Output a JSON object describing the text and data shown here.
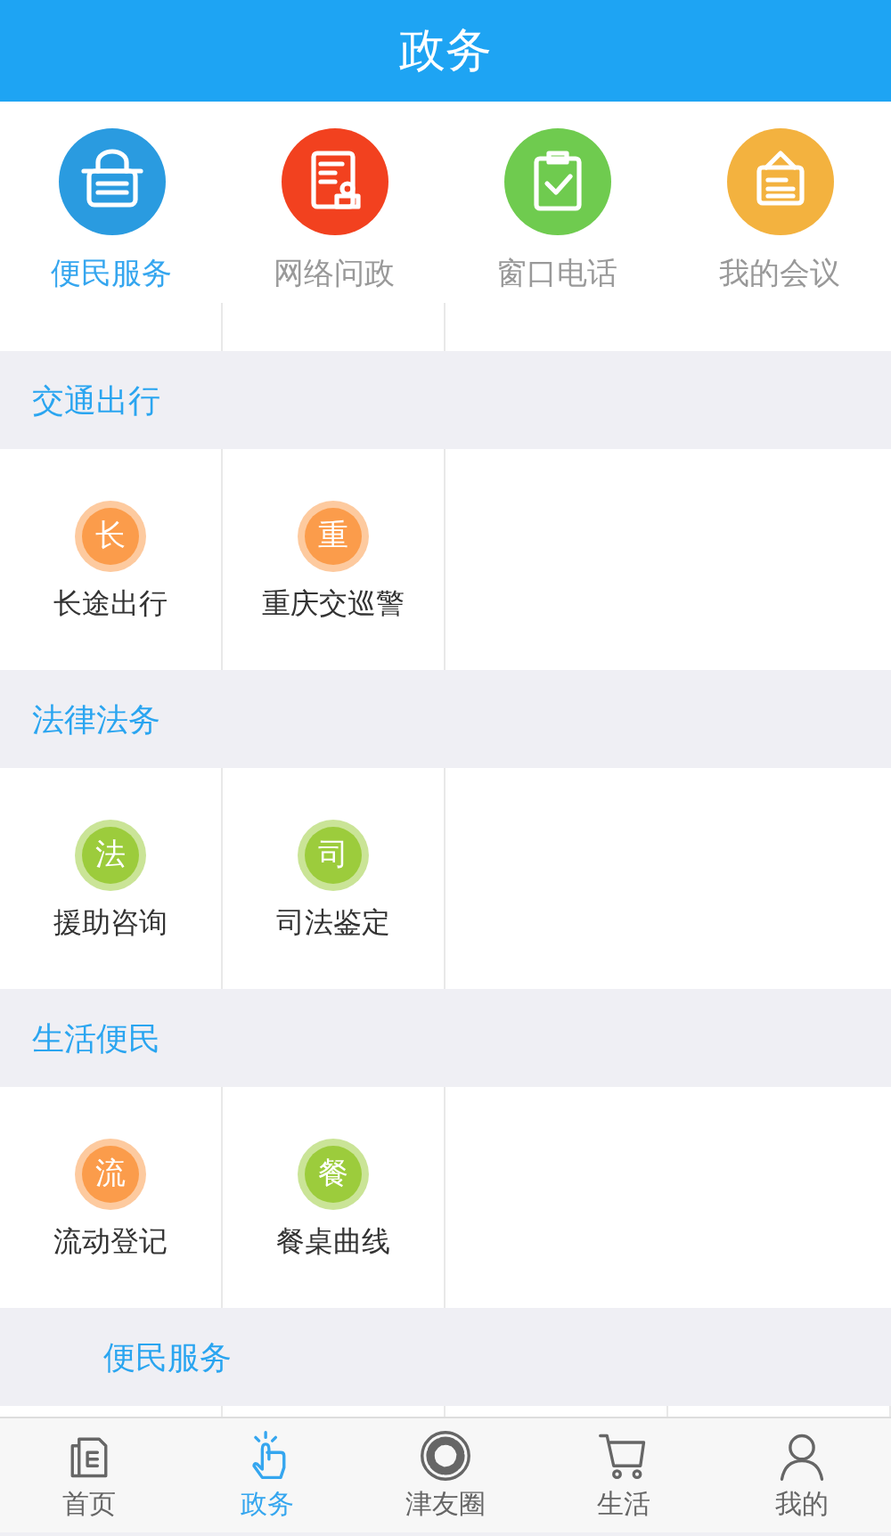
{
  "header": {
    "title": "政务"
  },
  "top_services": [
    {
      "label": "便民服务",
      "kind": "basket",
      "color": "#2a9be0",
      "selected": true
    },
    {
      "label": "网络问政",
      "kind": "document",
      "color": "#f2411f",
      "selected": false
    },
    {
      "label": "窗口电话",
      "kind": "clipboard",
      "color": "#6fcb4f",
      "selected": false
    },
    {
      "label": "我的会议",
      "kind": "sign",
      "color": "#f3b23f",
      "selected": false
    }
  ],
  "sections": [
    {
      "title": "交通出行",
      "items": [
        {
          "glyph": "长",
          "label": "长途出行",
          "color": "#fb9c4b"
        },
        {
          "glyph": "重",
          "label": "重庆交巡警",
          "color": "#fb9c4b"
        }
      ]
    },
    {
      "title": "法律法务",
      "items": [
        {
          "glyph": "法",
          "label": "援助咨询",
          "color": "#9ccc3c"
        },
        {
          "glyph": "司",
          "label": "司法鉴定",
          "color": "#9ccc3c"
        }
      ]
    },
    {
      "title": "生活便民",
      "items": [
        {
          "glyph": "流",
          "label": "流动登记",
          "color": "#fb9c4b"
        },
        {
          "glyph": "餐",
          "label": "餐桌曲线",
          "color": "#9ccc3c"
        }
      ]
    }
  ],
  "partial_section": {
    "title": "便民服务"
  },
  "tab_bar": [
    {
      "label": "首页",
      "kind": "home",
      "selected": false
    },
    {
      "label": "政务",
      "kind": "hand",
      "selected": true
    },
    {
      "label": "津友圈",
      "kind": "shutter",
      "selected": false
    },
    {
      "label": "生活",
      "kind": "cart",
      "selected": false
    },
    {
      "label": "我的",
      "kind": "person",
      "selected": false
    }
  ]
}
